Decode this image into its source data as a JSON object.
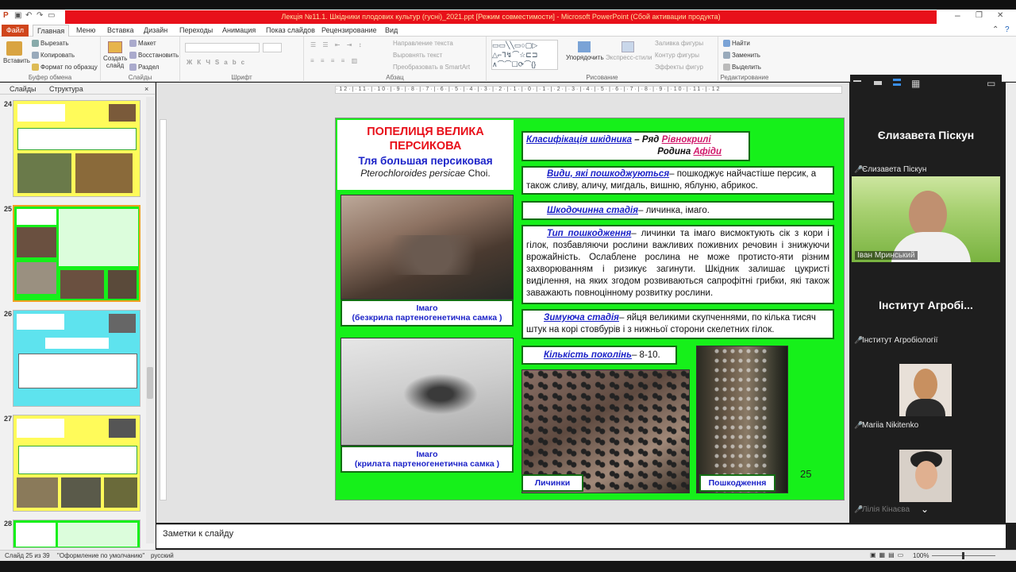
{
  "window": {
    "title": "Лекція №11.1. Шкідники плодових культур (гусні)_2021.ppt [Режим совместимости] - Microsoft PowerPoint (Сбой активации продукта)"
  },
  "tabs": [
    "Файл",
    "Главная",
    "Меню",
    "Вставка",
    "Дизайн",
    "Переходы",
    "Анимация",
    "Показ слайдов",
    "Рецензирование",
    "Вид"
  ],
  "ribbon": {
    "clipboard": {
      "label": "Буфер обмена",
      "paste": "Вставить",
      "cut": "Вырезать",
      "copy": "Копировать",
      "format": "Формат по образцу"
    },
    "slides": {
      "label": "Слайды",
      "create": "Создать слайд",
      "layout": "Макет",
      "reset": "Восстановить",
      "section": "Раздел"
    },
    "font": {
      "label": "Шрифт"
    },
    "paragraph": {
      "label": "Абзац",
      "direction": "Направление текста",
      "align": "Выровнять текст",
      "smartart": "Преобразовать в SmartArt"
    },
    "drawing": {
      "label": "Рисование",
      "arrange": "Упорядочить",
      "styles": "Экспресс-стили",
      "fill": "Заливка фигуры",
      "outline": "Контур фигуры",
      "effects": "Эффекты фигур"
    },
    "editing": {
      "label": "Редактирование",
      "find": "Найти",
      "replace": "Заменить",
      "select": "Выделить"
    }
  },
  "panel": {
    "tab_slides": "Слайды",
    "tab_outline": "Структура",
    "slides": [
      24,
      25,
      26,
      27,
      28
    ]
  },
  "slide": {
    "title_ua": "ПОПЕЛИЦЯ ВЕЛИКА ПЕРСИКОВА",
    "title_ru": "Тля большая персиковая",
    "latin": "Pterochloroides persicae",
    "author": "Choi.",
    "classif_label": "Класифікація шкідника",
    "order_prefix": "– Ряд",
    "order": "Рівнокрилі",
    "family_prefix": "Родина",
    "family": "Афіди",
    "species_label": "Види, які пошкоджуються",
    "species_text": "– пошкоджує найчастіше персик, а також сливу, аличу, мигдаль, вишню, яблуню, абрикос.",
    "stage_label": "Шкодочинна стадія",
    "stage_text": "– личинка,  імаго.",
    "damage_label": "Тип пошкодження",
    "damage_text": "– личинки  та імаго висмоктують сік з кори і гілок, позбавляючи рослини важливих поживних речовин і знижуючи врожайність. Ослаблене рослина не може протисто-яти різним захворюванням і ризикує загинути. Шкідник залишає цукристі виділення, на яких згодом розвиваються сапрофітні грибки, які також заважають повноцінному розвитку рослини.",
    "winter_label": "Зимуюча стадія",
    "winter_text": "– яйця великими скупченнями, по кілька тисяч штук на корі стовбурів і з нижньої сторони скелетних гілок.",
    "gen_label": "Кількість поколінь",
    "gen_text": "–  8-10.",
    "cap1_a": "Імаго",
    "cap1_b": "(безкрила партеногенетична самка )",
    "cap2_a": "Імаго",
    "cap2_b": "(крилата партеногенетична самка )",
    "cap_larvae": "Личинки",
    "cap_damage": "Пошкодження",
    "number": "25"
  },
  "notes": {
    "placeholder": "Заметки к слайду"
  },
  "status": {
    "slide": "Слайд 25 из 39",
    "theme": "\"Оформление по умолчанию\"",
    "lang": "русский",
    "zoom": "100%"
  },
  "zoom_panel": {
    "p1_tile": "Єлизавета Піскун",
    "p1_label": "Єлизавета Піскун",
    "p2_label": "Іван Мринський",
    "p3_tile": "Інститут  Агробі...",
    "p3_label": "Інститут Агробіології",
    "p4_label": "Mariia Nikitenko",
    "p5_label": "Лілія Кінаєва"
  },
  "colors": {
    "slide_bg": "#16f01a",
    "title_red": "#e8101a",
    "link_blue": "#1c23c8",
    "file_tab": "#d0451b"
  }
}
